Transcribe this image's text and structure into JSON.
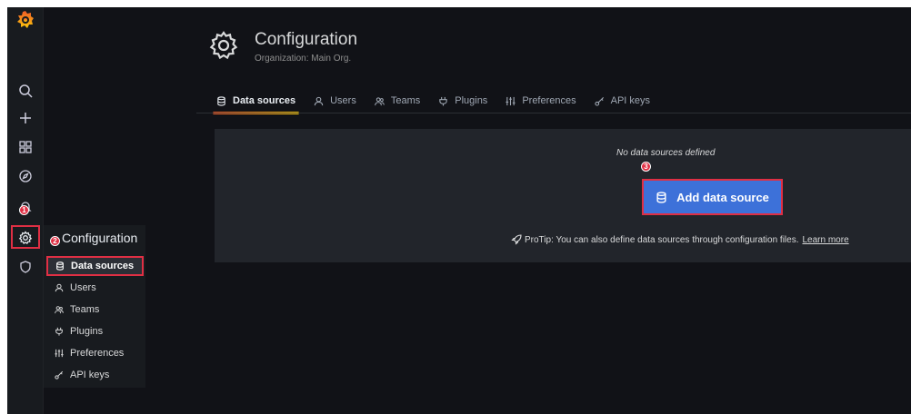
{
  "colors": {
    "background": "#111217",
    "sidebar": "#181b1f",
    "panel": "#22252b",
    "primary_button": "#3d71d9",
    "highlight": "#e02f44",
    "tab_accent": "#f05a28"
  },
  "sidebar": {
    "icons": [
      "grafana-logo-icon",
      "search-icon",
      "plus-icon",
      "dashboards-grid-icon",
      "explore-compass-icon",
      "alerting-bell-icon",
      "gear-icon",
      "shield-icon"
    ]
  },
  "header": {
    "title": "Configuration",
    "subtitle": "Organization: Main Org.",
    "tabs": [
      {
        "label": "Data sources",
        "icon": "database-icon",
        "active": true
      },
      {
        "label": "Users",
        "icon": "user-icon",
        "active": false
      },
      {
        "label": "Teams",
        "icon": "users-icon",
        "active": false
      },
      {
        "label": "Plugins",
        "icon": "plug-icon",
        "active": false
      },
      {
        "label": "Preferences",
        "icon": "sliders-icon",
        "active": false
      },
      {
        "label": "API keys",
        "icon": "key-icon",
        "active": false
      }
    ]
  },
  "main": {
    "empty_message": "No data sources defined",
    "add_button_label": "Add data source",
    "protip_text": "ProTip: You can also define data sources through configuration files.",
    "protip_link": "Learn more"
  },
  "flyout": {
    "title": "Configuration",
    "items": [
      {
        "label": "Data sources",
        "icon": "database-icon",
        "active": true
      },
      {
        "label": "Users",
        "icon": "user-icon",
        "active": false
      },
      {
        "label": "Teams",
        "icon": "users-icon",
        "active": false
      },
      {
        "label": "Plugins",
        "icon": "plug-icon",
        "active": false
      },
      {
        "label": "Preferences",
        "icon": "sliders-icon",
        "active": false
      },
      {
        "label": "API keys",
        "icon": "key-icon",
        "active": false
      }
    ]
  },
  "annotations": {
    "markers": [
      "1",
      "2",
      "3"
    ]
  }
}
